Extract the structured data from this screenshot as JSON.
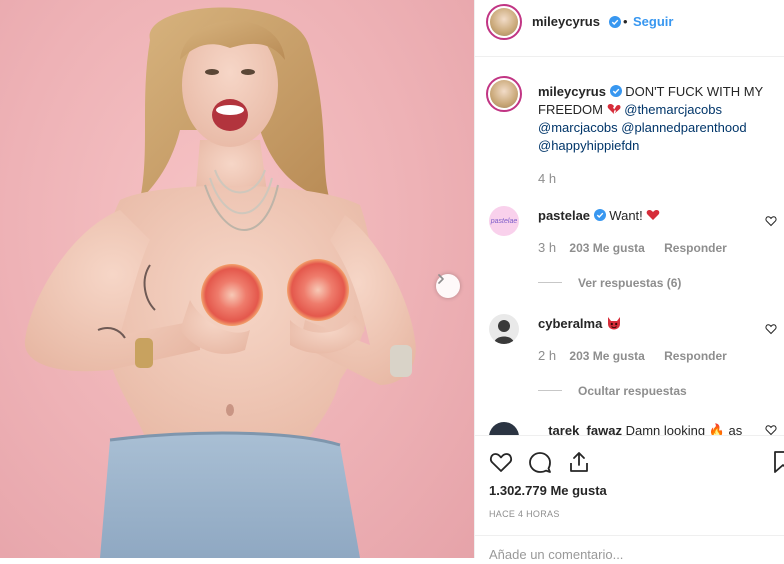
{
  "header": {
    "username": "mileycyrus",
    "separator": "•",
    "follow_label": "Seguir"
  },
  "caption": {
    "username": "mileycyrus",
    "line1_text": "DON'T FUCK WITH MY",
    "line2_text": "FREEDOM",
    "mention_1": "@themarcjacobs",
    "mention_2": "@marcjacobs",
    "mention_3": "@plannedparenthood",
    "mention_4": "@happyhippiefdn",
    "time": "4 h"
  },
  "comments": [
    {
      "username": "pastelae",
      "avatar_text": "pastelae",
      "text": "Want!",
      "time": "3 h",
      "likes": "203 Me gusta",
      "reply_label": "Responder",
      "replies_toggle": "Ver respuestas (6)"
    },
    {
      "username": "cyberalma",
      "text": "",
      "time": "2 h",
      "likes": "203 Me gusta",
      "reply_label": "Responder",
      "replies_toggle": "Ocultar respuestas"
    },
    {
      "username": "_tarek_fawaz",
      "text": "Damn looking",
      "trailing_text": "as"
    }
  ],
  "likes_label": "1.302.779 Me gusta",
  "timestamp": "HACE 4 HORAS",
  "comment_placeholder": "Añade un comentario...",
  "icons": {
    "verified": "verified-badge-icon",
    "heart": "heart-icon",
    "comment": "comment-icon",
    "share": "share-icon",
    "save": "bookmark-icon",
    "next": "chevron-right-icon"
  },
  "colors": {
    "link": "#003569",
    "verified": "#3897f0",
    "muted": "#8e8e8e",
    "photo_bg": "#eeb2b6"
  }
}
